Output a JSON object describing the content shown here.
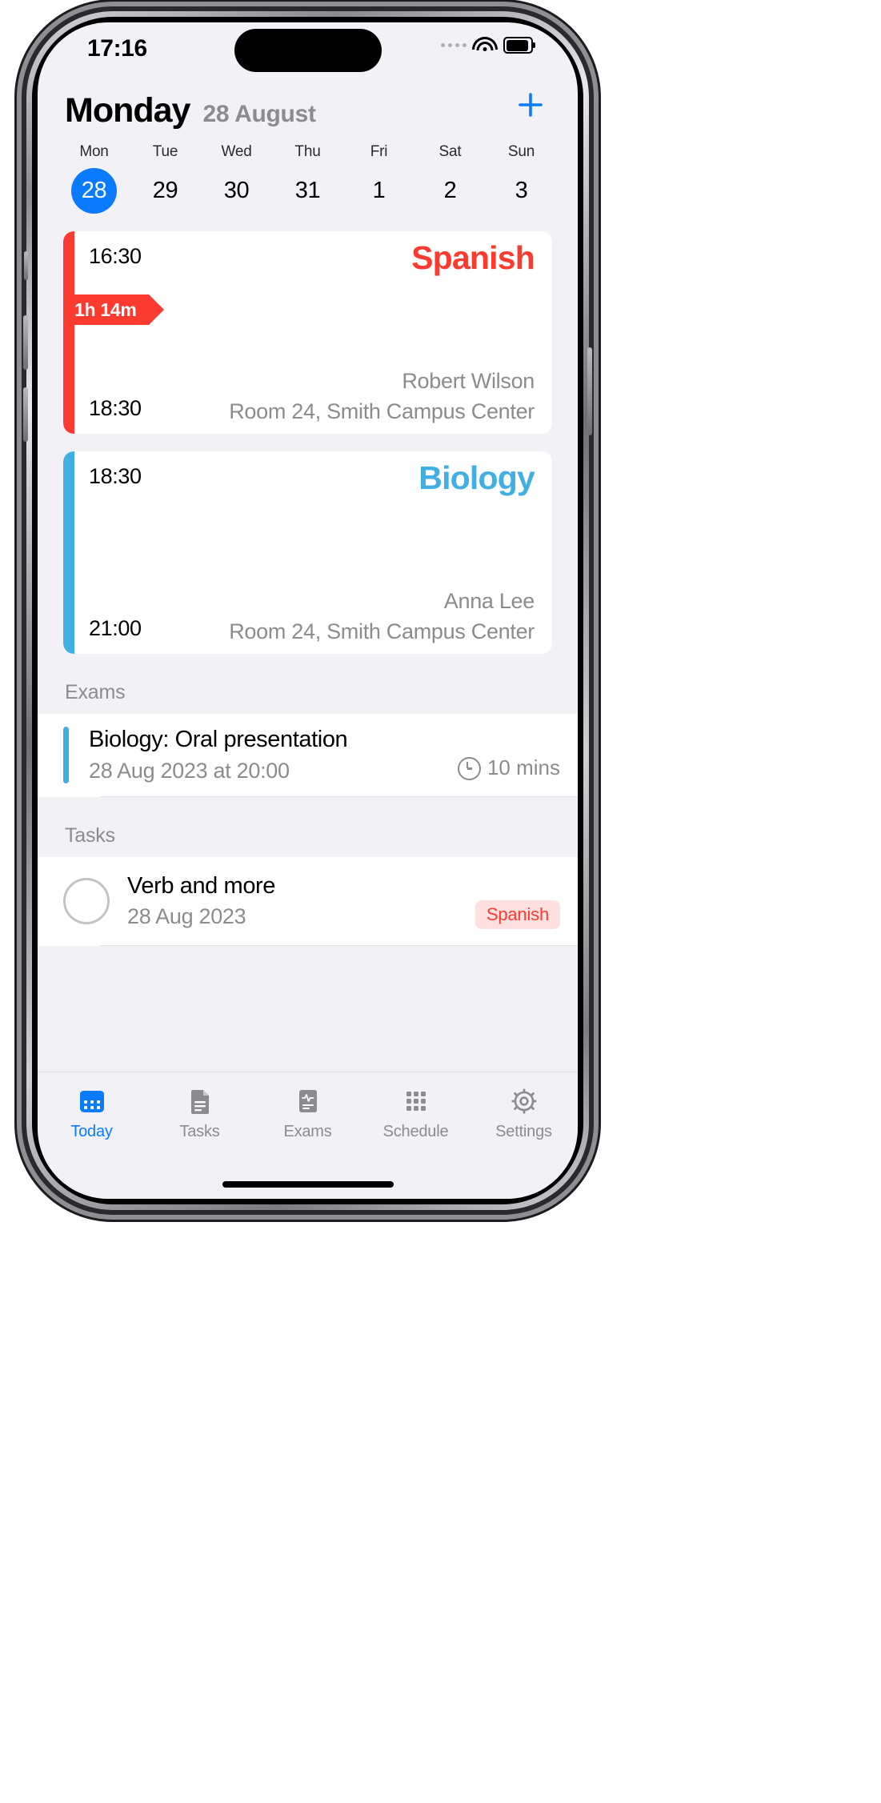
{
  "status_bar": {
    "time": "17:16",
    "icons": [
      "cellular-dots-icon",
      "wifi-icon",
      "battery-icon"
    ]
  },
  "header": {
    "day_name": "Monday",
    "date_label": "28 August",
    "add_button": "+"
  },
  "week_strip": {
    "days": [
      {
        "dow": "Mon",
        "num": "28",
        "selected": true
      },
      {
        "dow": "Tue",
        "num": "29",
        "selected": false
      },
      {
        "dow": "Wed",
        "num": "30",
        "selected": false
      },
      {
        "dow": "Thu",
        "num": "31",
        "selected": false
      },
      {
        "dow": "Fri",
        "num": "1",
        "selected": false
      },
      {
        "dow": "Sat",
        "num": "2",
        "selected": false
      },
      {
        "dow": "Sun",
        "num": "3",
        "selected": false
      }
    ]
  },
  "lessons": [
    {
      "title": "Spanish",
      "start": "16:30",
      "end": "18:30",
      "teacher": "Robert Wilson",
      "room": "Room 24, Smith Campus Center",
      "remaining": "1h 14m",
      "color": "#fb3b30"
    },
    {
      "title": "Biology",
      "start": "18:30",
      "end": "21:00",
      "teacher": "Anna Lee",
      "room": "Room 24, Smith Campus Center",
      "remaining": "",
      "color": "#41aee4"
    }
  ],
  "exams_section": {
    "heading": "Exams",
    "items": [
      {
        "title": "Biology: Oral presentation",
        "datetime": "28 Aug 2023 at 20:00",
        "duration": "10 mins",
        "bar_color": "#41aee4"
      }
    ]
  },
  "tasks_section": {
    "heading": "Tasks",
    "items": [
      {
        "title": "Verb and more",
        "date": "28 Aug 2023",
        "tag": "Spanish",
        "tag_color": "#fb3b30",
        "tag_bg": "#ffe0de",
        "done": false
      }
    ]
  },
  "tab_bar": {
    "accent": "#0a7bff",
    "inactive": "#8b8b90",
    "tabs": [
      {
        "label": "Today",
        "icon": "calendar-icon",
        "active": true
      },
      {
        "label": "Tasks",
        "icon": "document-icon",
        "active": false
      },
      {
        "label": "Exams",
        "icon": "exam-sheet-icon",
        "active": false
      },
      {
        "label": "Schedule",
        "icon": "grid-icon",
        "active": false
      },
      {
        "label": "Settings",
        "icon": "gear-icon",
        "active": false
      }
    ]
  }
}
